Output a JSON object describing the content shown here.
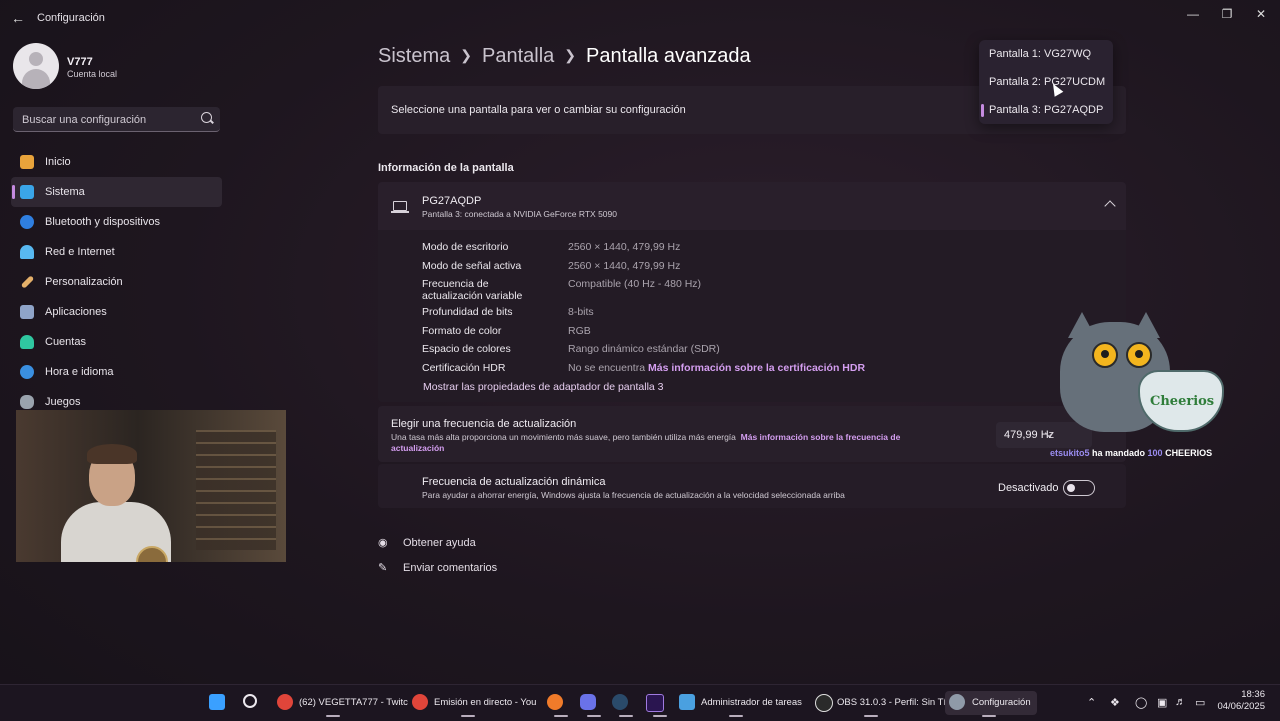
{
  "window": {
    "title": "Configuración",
    "back_icon": "arrow-left-icon",
    "controls": [
      "minimize",
      "maximize",
      "close"
    ]
  },
  "profile": {
    "name": "V777",
    "account_type": "Cuenta local"
  },
  "search": {
    "placeholder": "Buscar una configuración"
  },
  "sidebar": {
    "items": [
      {
        "label": "Inicio",
        "icon": "home-icon",
        "color": "#e8a33b",
        "active": false
      },
      {
        "label": "Sistema",
        "icon": "system-icon",
        "color": "#3aa5e8",
        "active": true
      },
      {
        "label": "Bluetooth y dispositivos",
        "icon": "bluetooth-icon",
        "color": "#2f7fe0",
        "active": false
      },
      {
        "label": "Red e Internet",
        "icon": "wifi-icon",
        "color": "#58b8f0",
        "active": false
      },
      {
        "label": "Personalización",
        "icon": "brush-icon",
        "color": "#e4b06a",
        "active": false
      },
      {
        "label": "Aplicaciones",
        "icon": "apps-icon",
        "color": "#8fa4c8",
        "active": false
      },
      {
        "label": "Cuentas",
        "icon": "person-icon",
        "color": "#2fc7a0",
        "active": false
      },
      {
        "label": "Hora e idioma",
        "icon": "globe-icon",
        "color": "#3a8fe0",
        "active": false
      },
      {
        "label": "Juegos",
        "icon": "gamepad-icon",
        "color": "#9aa3ad",
        "active": false
      }
    ]
  },
  "breadcrumb": {
    "level1": "Sistema",
    "level2": "Pantalla",
    "current": "Pantalla avanzada"
  },
  "display_select": {
    "prompt": "Seleccione una pantalla para ver o cambiar su configuración",
    "options": [
      "Pantalla 1: VG27WQ",
      "Pantalla 2: PG27UCDM",
      "Pantalla 3: PG27AQDP"
    ],
    "selected_index": 2
  },
  "display_info": {
    "section_title": "Información de la pantalla",
    "monitor_name": "PG27AQDP",
    "monitor_sub": "Pantalla 3: conectada a NVIDIA GeForce RTX 5090",
    "specs": [
      {
        "key": "Modo de escritorio",
        "value": "2560 × 1440, 479,99 Hz"
      },
      {
        "key": "Modo de señal activa",
        "value": "2560 × 1440, 479,99 Hz"
      },
      {
        "key": "Frecuencia de actualización variable",
        "value": "Compatible (40 Hz - 480 Hz)"
      },
      {
        "key": "Profundidad de bits",
        "value": "8-bits"
      },
      {
        "key": "Formato de color",
        "value": "RGB"
      },
      {
        "key": "Espacio de colores",
        "value": "Rango dinámico estándar (SDR)"
      },
      {
        "key": "Certificación HDR",
        "value": "No se encuentra",
        "link": "Más información sobre la certificación HDR"
      }
    ],
    "adapter_link": "Mostrar las propiedades de adaptador de pantalla 3"
  },
  "refresh_rate": {
    "title": "Elegir una frecuencia de actualización",
    "desc": "Una tasa más alta proporciona un movimiento más suave, pero también utiliza más energía",
    "desc_link": "Más información sobre la frecuencia de actualización",
    "value": "479,99 Hz"
  },
  "dynamic_refresh": {
    "title": "Frecuencia de actualización dinámica",
    "desc": "Para ayudar a ahorrar energía, Windows ajusta la frecuencia de actualización a la velocidad seleccionada arriba",
    "state": "Desactivado",
    "enabled": false
  },
  "help_links": {
    "help": "Obtener ayuda",
    "feedback": "Enviar comentarios"
  },
  "overlay": {
    "alert_user": "etsukito5",
    "alert_mid": " ha mandado ",
    "alert_amount": "100",
    "alert_item": " CHEERIOS",
    "bowl_text": "Cheerios"
  },
  "taskbar": {
    "apps": [
      {
        "label": "(62) VEGETTA777 - Twitc",
        "icon": "chrome-icon"
      },
      {
        "label": "Emisión en directo - You",
        "icon": "chrome-icon"
      },
      {
        "label": "",
        "icon": "firefox-icon"
      },
      {
        "label": "",
        "icon": "discord-icon"
      },
      {
        "label": "",
        "icon": "steam-icon"
      },
      {
        "label": "",
        "icon": "premiere-icon"
      },
      {
        "label": "Administrador de tareas",
        "icon": "task-manager-icon"
      },
      {
        "label": "OBS 31.0.3 - Perfil: Sin Tí",
        "icon": "obs-icon"
      },
      {
        "label": "Configuración",
        "icon": "settings-icon"
      }
    ],
    "time": "18:36",
    "date": "04/06/2025"
  }
}
